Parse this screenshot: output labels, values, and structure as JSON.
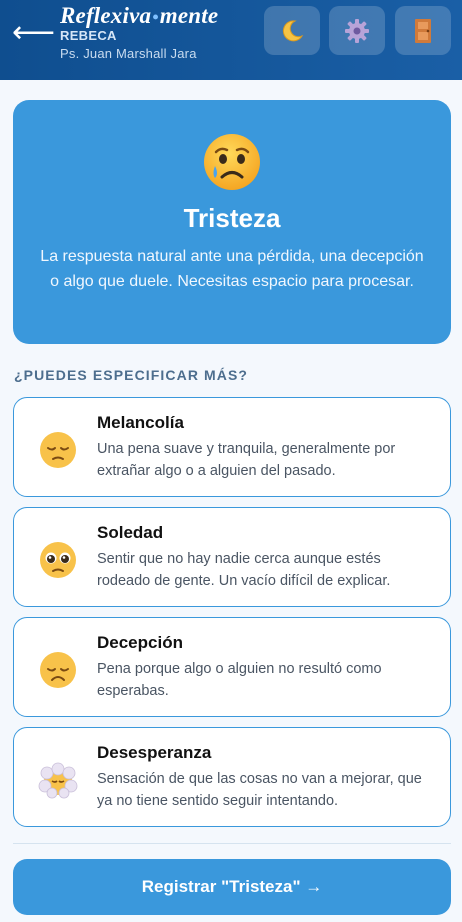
{
  "header": {
    "back_label": "⟵",
    "brand_part1": "Reflexiva",
    "brand_dot": "•",
    "brand_part2": "mente",
    "patient_name": "REBECA",
    "therapist": "Ps. Juan Marshall Jara",
    "buttons": [
      {
        "icon": "moon-icon"
      },
      {
        "icon": "gear-icon"
      },
      {
        "icon": "door-icon"
      }
    ]
  },
  "emotion": {
    "emoji": "crying-face-icon",
    "title": "Tristeza",
    "description": "La respuesta natural ante una pérdida, una decepción o algo que duele. Necesitas espacio para procesar."
  },
  "section_label": "¿PUEDES ESPECIFICAR MÁS?",
  "options": [
    {
      "name": "Melancolía",
      "description": "Una pena suave y tranquila, generalmente por extrañar algo o a alguien del pasado.",
      "icon": "pensive-face-icon"
    },
    {
      "name": "Soledad",
      "description": "Sentir que no hay nadie cerca aunque estés rodeado de gente. Un vacío difícil de explicar.",
      "icon": "pleading-face-icon"
    },
    {
      "name": "Decepción",
      "description": "Pena porque algo o alguien no resultó como esperabas.",
      "icon": "disappointed-face-icon"
    },
    {
      "name": "Desesperanza",
      "description": "Sensación de que las cosas no van a mejorar, que ya no tiene sentido seguir intentando.",
      "icon": "face-in-clouds-icon"
    }
  ],
  "submit_label": "Registrar \"Tristeza\" →",
  "colors": {
    "header": "#1a5fa6",
    "accent": "#3a98dc",
    "section_label": "#4d6e8e",
    "background": "#f4f8fd"
  }
}
